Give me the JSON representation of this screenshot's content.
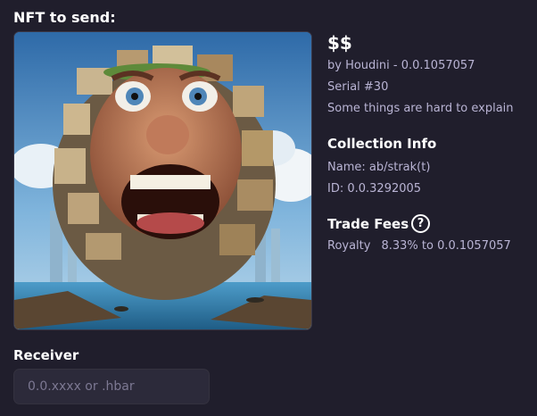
{
  "send": {
    "section_title": "NFT to send:"
  },
  "nft": {
    "image_alt": "$$",
    "title": "$$",
    "creator_line": "by Houdini - 0.0.1057057",
    "serial": "Serial #30",
    "description": "Some things are hard to explain"
  },
  "collection": {
    "heading": "Collection Info",
    "name_line": "Name: ab/strak(t)",
    "id_line": "ID: 0.0.3292005"
  },
  "fees": {
    "heading": "Trade Fees",
    "help_glyph": "?",
    "royalty_label": "Royalty",
    "royalty_value": "8.33% to 0.0.1057057"
  },
  "receiver": {
    "label": "Receiver",
    "value": "",
    "placeholder": "0.0.xxxx or .hbar"
  },
  "colors": {
    "background": "#201e2c",
    "muted_text": "#b9b4d4",
    "input_background": "#2c2a3a"
  },
  "icons": {
    "help": "question-circle-icon"
  }
}
